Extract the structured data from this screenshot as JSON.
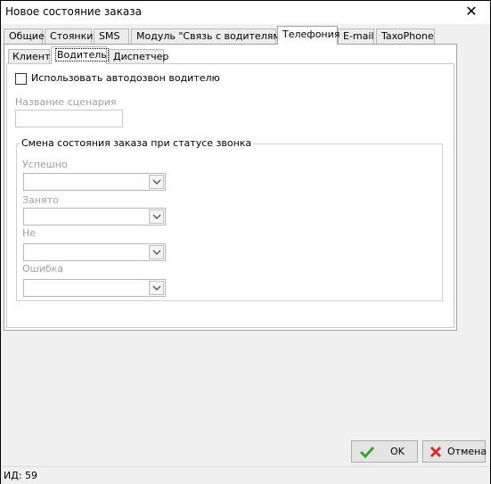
{
  "window": {
    "title": "Новое состояние заказа"
  },
  "tabs": [
    {
      "label": "Общие"
    },
    {
      "label": "Стоянки"
    },
    {
      "label": "SMS"
    },
    {
      "label": "Модуль \"Связь с водителями\""
    },
    {
      "label": "Телефония"
    },
    {
      "label": "E-mail"
    },
    {
      "label": "TaxoPhone"
    }
  ],
  "active_tab": "Телефония",
  "subtabs": [
    {
      "label": "Клиент"
    },
    {
      "label": "Водитель"
    },
    {
      "label": "Диспетчер"
    }
  ],
  "active_subtab": "Водитель",
  "driver_panel": {
    "autodial_checkbox_label": "Использовать автодозвон водителю",
    "autodial_checked": false,
    "scenario_label": "Название сценария",
    "scenario_value": "",
    "group_title": "Смена состояния заказа при статусе звонка",
    "combos": [
      {
        "label": "Успешно",
        "value": ""
      },
      {
        "label": "Занято",
        "value": ""
      },
      {
        "label": "Не",
        "value": ""
      },
      {
        "label": "Ошибка",
        "value": ""
      }
    ]
  },
  "buttons": {
    "ok": "OK",
    "cancel": "Отмена"
  },
  "status": {
    "text": "ИД: 59"
  },
  "colors": {
    "ok_check": "#3ca03c",
    "cancel_x": "#d03030",
    "disabled_text": "#a0a0a0"
  },
  "icons": {
    "ok": "check-icon",
    "cancel": "x-icon",
    "combo": "chevron-down-icon",
    "close": "close-icon"
  }
}
